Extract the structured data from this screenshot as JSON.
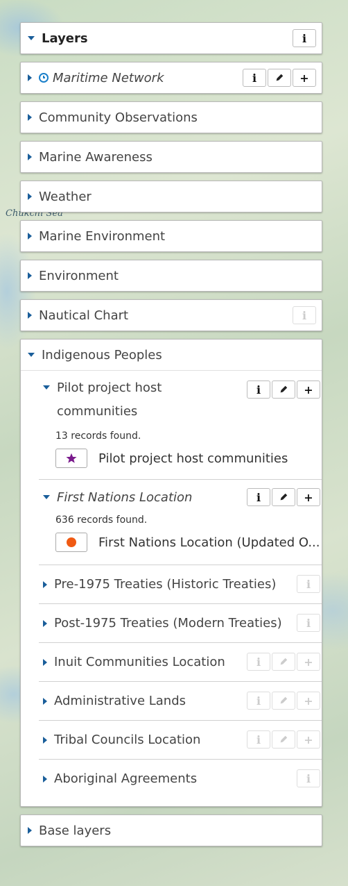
{
  "map": {
    "sea_label": "Chukchi Sea"
  },
  "layers_panel": {
    "title": "Layers",
    "groups": [
      {
        "label": "Maritime Network"
      },
      {
        "label": "Community Observations"
      },
      {
        "label": "Marine Awareness"
      },
      {
        "label": "Weather"
      },
      {
        "label": "Marine Environment"
      },
      {
        "label": "Environment"
      },
      {
        "label": "Nautical Chart"
      },
      {
        "label": "Indigenous Peoples"
      }
    ],
    "indigenous": {
      "pilot": {
        "label": "Pilot project host communities",
        "count": "13 records found.",
        "legend": "Pilot project host communities"
      },
      "first_nations": {
        "label": "First Nations Location",
        "count": "636 records found.",
        "legend": "First Nations Location (Updated O..."
      },
      "items": [
        {
          "label": "Pre-1975 Treaties (Historic Treaties)"
        },
        {
          "label": "Post-1975 Treaties (Modern Treaties)"
        },
        {
          "label": "Inuit Communities Location"
        },
        {
          "label": "Administrative Lands"
        },
        {
          "label": "Tribal Councils Location"
        },
        {
          "label": "Aboriginal Agreements"
        }
      ]
    },
    "base_layers": {
      "label": "Base layers"
    }
  },
  "buttons": {
    "info": "i",
    "add": "+"
  },
  "colors": {
    "accent": "#1a5e9a",
    "star": "#7a1a8c",
    "dot": "#f05a13",
    "clock": "#1a7fc9"
  },
  "icons": {
    "expand": "triangle-right",
    "collapse": "triangle-down",
    "info": "info-icon",
    "edit": "pencil-icon",
    "add": "plus-icon",
    "time": "clock-icon",
    "star": "star-icon",
    "dot": "circle-icon"
  }
}
